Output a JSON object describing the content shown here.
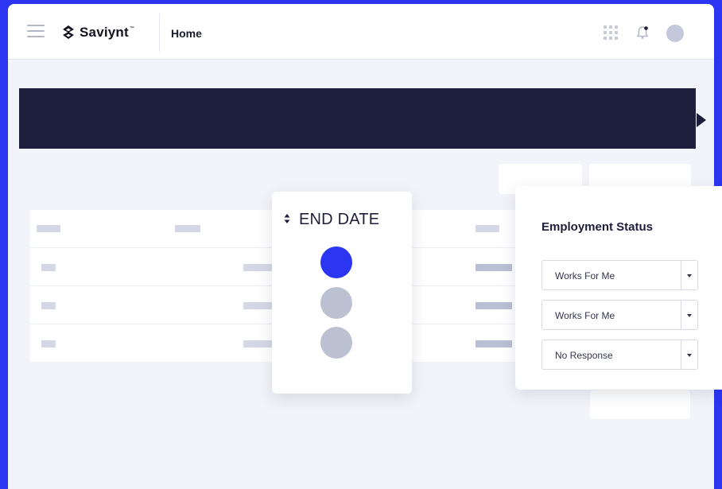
{
  "header": {
    "brand": "Saviynt",
    "brand_tm": "™",
    "page_title": "Home",
    "icons": [
      "menu-icon",
      "apps-grid-icon",
      "bell-icon",
      "avatar"
    ]
  },
  "enddate_panel": {
    "sort_icon": "sort-icon",
    "title": "END DATE",
    "options": [
      {
        "selected": true
      },
      {
        "selected": false
      },
      {
        "selected": false
      }
    ]
  },
  "employment_panel": {
    "title": "Employment Status",
    "selects": [
      {
        "value": "Works For Me"
      },
      {
        "value": "Works For Me"
      },
      {
        "value": "No Response"
      }
    ],
    "caret_icon": "caret-down-icon"
  },
  "colors": {
    "accent": "#2b35f2",
    "banner": "#1d1e3c",
    "placeholder": "#d4d8e6",
    "radio_inactive": "#bcc1d2"
  }
}
